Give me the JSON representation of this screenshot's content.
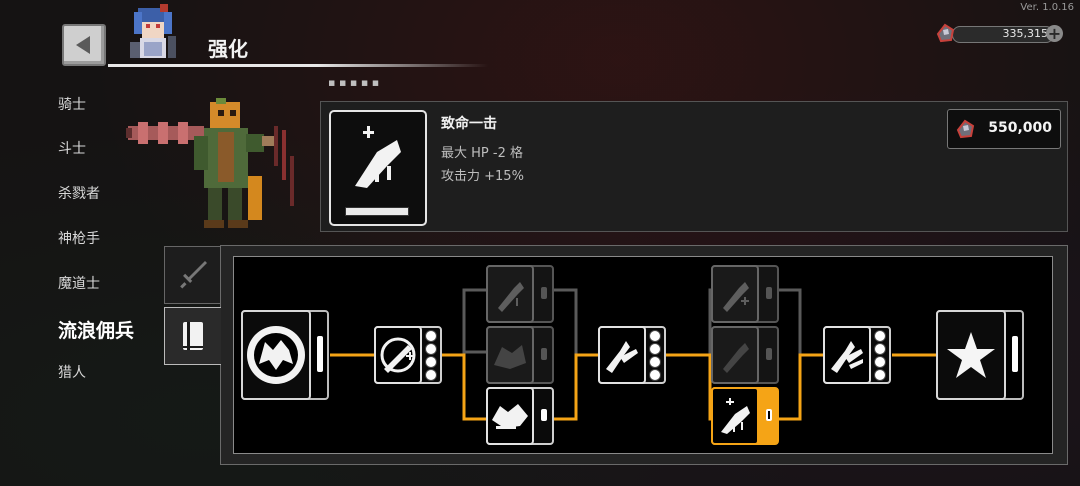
{
  "app": {
    "version": "Ver. 1.0.16"
  },
  "header": {
    "title": "强化",
    "back_icon": "back-arrow-icon"
  },
  "currency": {
    "value": "335,315",
    "icon": "gem-icon",
    "add_icon": "plus-icon"
  },
  "sidebar": {
    "items": [
      {
        "label": "骑士"
      },
      {
        "label": "斗士"
      },
      {
        "label": "杀戮者"
      },
      {
        "label": "神枪手"
      },
      {
        "label": "魔道士"
      },
      {
        "label": "流浪佣兵",
        "active": true
      },
      {
        "label": "猎人"
      }
    ]
  },
  "skill": {
    "name": "致命一击",
    "lines": [
      "最大 HP -2 格",
      "攻击力 +15%"
    ],
    "cost": "550,000",
    "icon": "blade-slash-icon"
  },
  "tabs": [
    {
      "icon": "sword-icon",
      "active": false
    },
    {
      "icon": "book-icon",
      "active": true
    }
  ],
  "tree": {
    "line_color": "#f5a416",
    "root_icon": "wolf-head-icon",
    "end_icon": "star-icon"
  }
}
